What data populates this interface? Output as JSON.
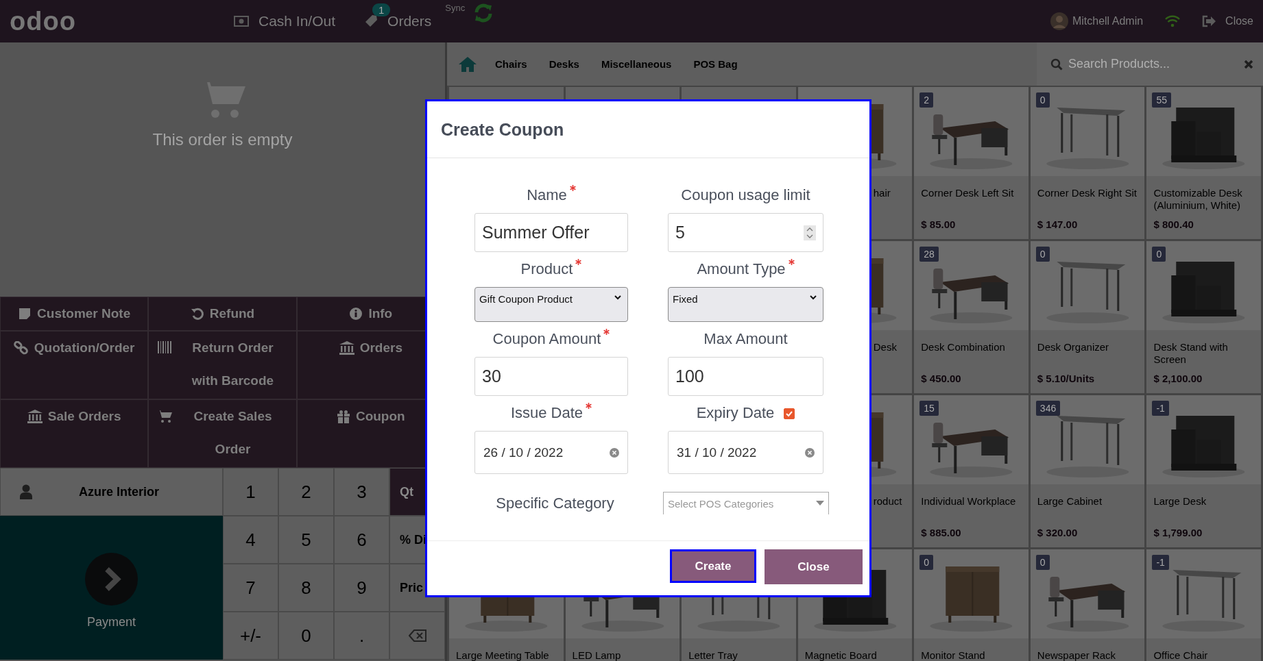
{
  "topbar": {
    "logo": "odoo",
    "cash": {
      "label": "Cash In/Out"
    },
    "orders": {
      "label": "Orders",
      "badge": "1"
    },
    "sync": "Sync",
    "user": "Mitchell Admin",
    "close": "Close"
  },
  "order": {
    "empty_text": "This order is empty"
  },
  "control_buttons": [
    {
      "label": "Customer Note"
    },
    {
      "label": "Refund"
    },
    {
      "label": "Info"
    },
    {
      "label": "Quotation/Order"
    },
    {
      "label": "Return Order with Barcode"
    },
    {
      "label": "Orders"
    },
    {
      "label": "Sale Orders"
    },
    {
      "label": "Create Sales Order"
    },
    {
      "label": "Coupon"
    }
  ],
  "customer": "Azure Interior",
  "numpad": {
    "keys": [
      "1",
      "2",
      "3",
      "4",
      "5",
      "6",
      "7",
      "8",
      "9",
      "+/-",
      "0",
      "."
    ],
    "modes": [
      {
        "label": "Qt",
        "selected": true
      },
      {
        "label": "% Di",
        "selected": false
      },
      {
        "label": "Pric",
        "selected": false
      }
    ]
  },
  "payment": "Payment",
  "categories": [
    "Chairs",
    "Desks",
    "Miscellaneous",
    "POS Bag"
  ],
  "search": {
    "placeholder": "Search Products..."
  },
  "products": [
    {
      "kind": "covered"
    },
    {
      "kind": "covered"
    },
    {
      "kind": "covered"
    },
    {
      "kind": "partial",
      "name": "hair"
    },
    {
      "kind": "product",
      "badge": "2",
      "name": "Corner Desk Left Sit",
      "price": "$ 85.00"
    },
    {
      "kind": "product",
      "badge": "0",
      "name": "Corner Desk Right Sit",
      "price": "$ 147.00"
    },
    {
      "kind": "product",
      "badge": "55",
      "name": "Customizable Desk (Aluminium, White)",
      "price": "$ 800.40"
    },
    {
      "kind": "partial",
      "name": "Desk"
    },
    {
      "kind": "product",
      "badge": "28",
      "name": "Desk Combination",
      "price": "$ 450.00"
    },
    {
      "kind": "product",
      "badge": "0",
      "name": "Desk Organizer",
      "price": "$ 5.10/Units"
    },
    {
      "kind": "product",
      "badge": "0",
      "name": "Desk Stand with Screen",
      "price": "$ 2,100.00"
    },
    {
      "kind": "partial",
      "name": "roduct"
    },
    {
      "kind": "product",
      "badge": "15",
      "name": "Individual Workplace",
      "price": "$ 885.00"
    },
    {
      "kind": "product",
      "badge": "346",
      "name": "Large Cabinet",
      "price": "$ 320.00"
    },
    {
      "kind": "product",
      "badge": "-1",
      "name": "Large Desk",
      "price": "$ 1,799.00"
    },
    {
      "kind": "product",
      "name": "Large Meeting Table"
    },
    {
      "kind": "product",
      "name": "LED Lamp"
    },
    {
      "kind": "product",
      "name": "Letter Tray"
    },
    {
      "kind": "product",
      "name": "Magnetic Board"
    },
    {
      "kind": "product",
      "badge": "0",
      "name": "Monitor Stand"
    },
    {
      "kind": "product",
      "badge": "0",
      "name": "Newspaper Rack"
    },
    {
      "kind": "product",
      "badge": "-1",
      "name": "Office Chair"
    }
  ],
  "modal": {
    "title": "Create Coupon",
    "fields": [
      {
        "kind": "text",
        "label": "Name",
        "required": true,
        "value": "Summer Offer"
      },
      {
        "kind": "number",
        "label": "Coupon usage limit",
        "required": false,
        "value": "5"
      },
      {
        "kind": "select",
        "label": "Product",
        "required": true,
        "value": "Gift Coupon Product"
      },
      {
        "kind": "select",
        "label": "Amount Type",
        "required": true,
        "value": "Fixed"
      },
      {
        "kind": "text",
        "label": "Coupon Amount",
        "required": true,
        "value": "30"
      },
      {
        "kind": "text",
        "label": "Max Amount",
        "required": false,
        "value": "100"
      },
      {
        "kind": "date",
        "label": "Issue Date",
        "required": true,
        "value": "26 / 10 / 2022"
      },
      {
        "kind": "date",
        "label": "Expiry Date",
        "required": false,
        "checked": true,
        "value": "31 / 10 / 2022"
      }
    ],
    "category": {
      "label": "Specific Category",
      "placeholder": "Select POS Categories"
    },
    "buttons": [
      {
        "label": "Create",
        "focused": true
      },
      {
        "label": "Close",
        "focused": false
      }
    ]
  }
}
